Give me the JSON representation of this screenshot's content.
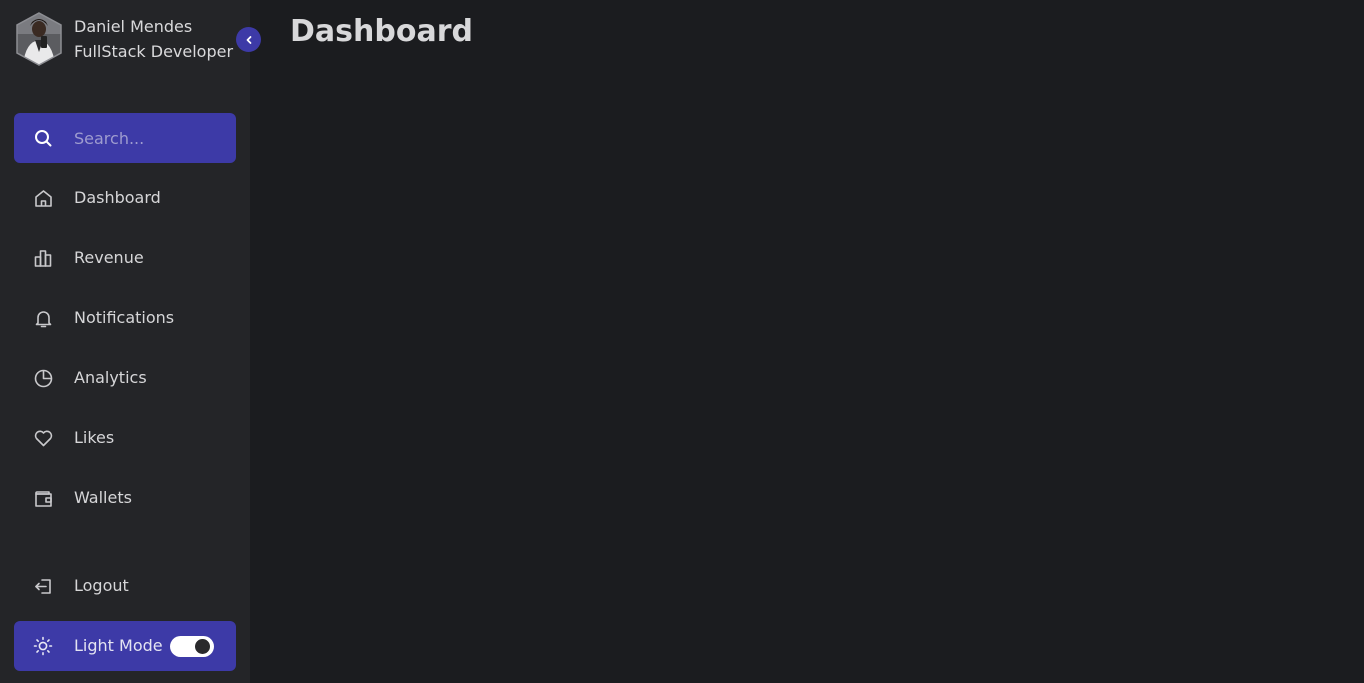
{
  "profile": {
    "name": "Daniel Mendes",
    "role": "FullStack Developer"
  },
  "search": {
    "placeholder": "Search...",
    "value": ""
  },
  "nav": {
    "items": [
      {
        "label": "Dashboard",
        "icon": "home-icon"
      },
      {
        "label": "Revenue",
        "icon": "bar-chart-icon"
      },
      {
        "label": "Notifications",
        "icon": "bell-icon"
      },
      {
        "label": "Analytics",
        "icon": "pie-chart-icon"
      },
      {
        "label": "Likes",
        "icon": "heart-icon"
      },
      {
        "label": "Wallets",
        "icon": "wallet-icon"
      }
    ],
    "logout": {
      "label": "Logout",
      "icon": "logout-icon"
    }
  },
  "mode": {
    "label": "Light Mode",
    "icon": "sun-icon",
    "toggle_on": true
  },
  "main": {
    "title": "Dashboard"
  },
  "colors": {
    "accent": "#3d3aa7",
    "sidebar_bg": "#242528",
    "main_bg": "#1b1c1f"
  }
}
